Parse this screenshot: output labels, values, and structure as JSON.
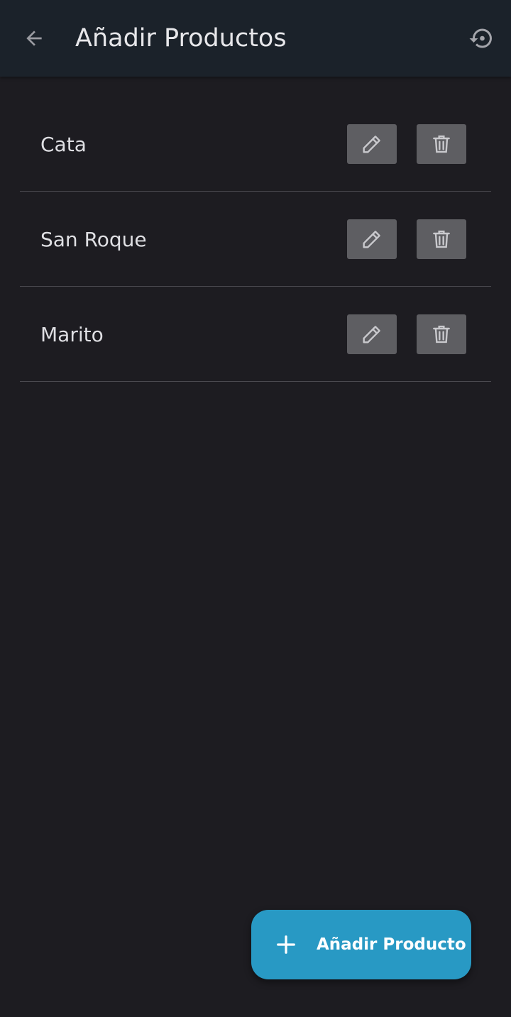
{
  "header": {
    "title": "Añadir Productos",
    "back_icon": "arrow-left-icon",
    "history_icon": "history-icon"
  },
  "products": [
    {
      "name": "Cata"
    },
    {
      "name": "San Roque"
    },
    {
      "name": "Marito"
    }
  ],
  "row_actions": {
    "edit_icon": "pencil-icon",
    "delete_icon": "trash-icon"
  },
  "fab": {
    "label": "Añadir Producto",
    "icon": "plus-icon"
  },
  "colors": {
    "background": "#1d1c21",
    "app_bar": "#1b222a",
    "action_button": "#5e5e62",
    "fab": "#2899c4",
    "text": "#dfdfe3"
  }
}
